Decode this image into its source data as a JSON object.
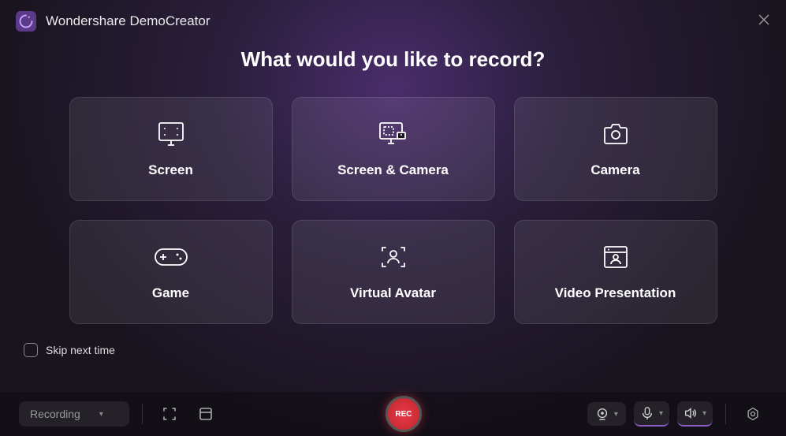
{
  "header": {
    "title": "Wondershare DemoCreator"
  },
  "main": {
    "heading": "What would you like to record?"
  },
  "cards": {
    "screen": "Screen",
    "screen_camera": "Screen & Camera",
    "camera": "Camera",
    "game": "Game",
    "avatar": "Virtual Avatar",
    "presentation": "Video Presentation"
  },
  "skip": {
    "label": "Skip next time",
    "checked": false
  },
  "toolbar": {
    "mode": "Recording",
    "rec_label": "REC"
  }
}
